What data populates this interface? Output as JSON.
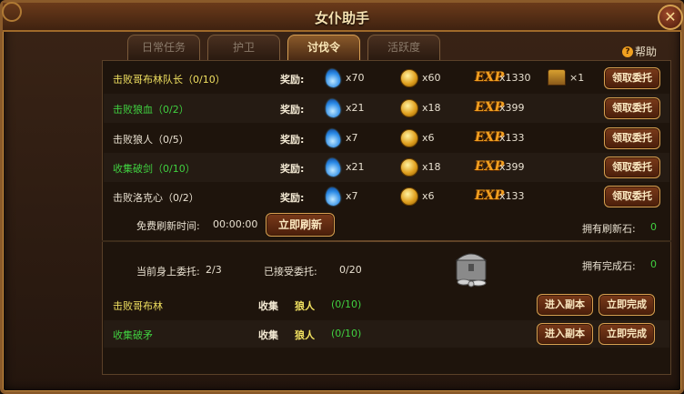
{
  "window": {
    "title": "女仆助手"
  },
  "tabs": [
    {
      "label": "日常任务",
      "active": false
    },
    {
      "label": "护卫",
      "active": false
    },
    {
      "label": "讨伐令",
      "active": true
    },
    {
      "label": "活跃度",
      "active": false
    }
  ],
  "help_label": "帮助",
  "reward_label": "奖励:",
  "claim_label": "领取委托",
  "tasks": [
    {
      "name": "击败哥布林队长（0/10）",
      "color": "#f0e060",
      "water": "x70",
      "coin": "x60",
      "exp": "x1330",
      "extra": "×1",
      "has_extra": true
    },
    {
      "name": "击败狼血（0/2）",
      "color": "#40d040",
      "water": "x21",
      "coin": "x18",
      "exp": "x399",
      "has_extra": false
    },
    {
      "name": "击败狼人（0/5）",
      "color": "#e8e0d0",
      "water": "x7",
      "coin": "x6",
      "exp": "x133",
      "has_extra": false
    },
    {
      "name": "收集破剑（0/10）",
      "color": "#40d040",
      "water": "x21",
      "coin": "x18",
      "exp": "x399",
      "has_extra": false
    },
    {
      "name": "击败洛克心（0/2）",
      "color": "#e8e0d0",
      "water": "x7",
      "coin": "x6",
      "exp": "x133",
      "has_extra": false
    }
  ],
  "refresh": {
    "free_label": "免费刷新时间:",
    "free_time": "00:00:00",
    "refresh_button": "立即刷新",
    "stones_label": "拥有刷新石:",
    "stones_value": "0"
  },
  "status": {
    "current_label": "当前身上委托:",
    "current_value": "2/3",
    "accepted_label": "已接受委托:",
    "accepted_value": "0/20",
    "complete_stones_label": "拥有完成石:",
    "complete_stones_value": "0"
  },
  "accepted": [
    {
      "name": "击败哥布林",
      "color": "#f0e060",
      "action": "收集",
      "target": "狼人",
      "progress": "(0/10)"
    },
    {
      "name": "收集破矛",
      "color": "#40d040",
      "action": "收集",
      "target": "狼人",
      "progress": "(0/10)"
    }
  ],
  "accepted_buttons": {
    "enter": "进入副本",
    "complete": "立即完成"
  },
  "colors": {
    "yellow": "#f0e060",
    "green": "#40d040",
    "accent": "#d8a050"
  }
}
